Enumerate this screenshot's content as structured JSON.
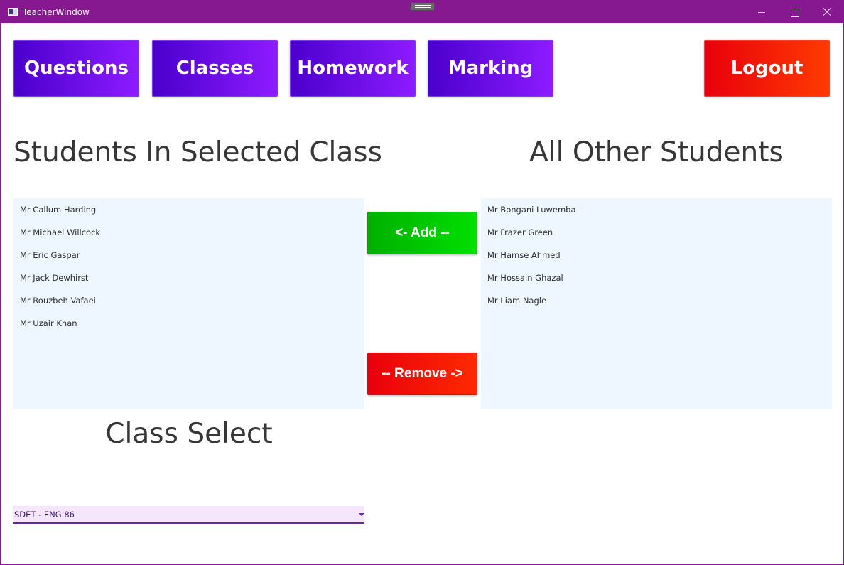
{
  "window": {
    "title": "TeacherWindow"
  },
  "nav": {
    "questions": "Questions",
    "classes": "Classes",
    "homework": "Homework",
    "marking": "Marking",
    "logout": "Logout"
  },
  "headings": {
    "selected_class": "Students In Selected Class",
    "other_students": "All Other Students",
    "class_select": "Class Select"
  },
  "students_in_class": [
    "Mr Callum Harding",
    "Mr Michael Willcock",
    "Mr Eric Gaspar",
    "Mr Jack Dewhirst",
    "Mr Rouzbeh Vafaei",
    "Mr Uzair Khan"
  ],
  "other_students": [
    "Mr Bongani Luwemba",
    "Mr Frazer Green",
    "Mr Hamse Ahmed",
    "Mr Hossain Ghazal",
    "Mr Liam Nagle"
  ],
  "actions": {
    "add": "<- Add --",
    "remove": "-- Remove ->"
  },
  "class_select": {
    "value": "SDET - ENG 86"
  },
  "colors": {
    "titlebar": "#86198f",
    "nav_gradient_start": "#4a00cc",
    "nav_gradient_end": "#8d1bff",
    "logout": "#ff1a00",
    "add": "#00c800",
    "remove": "#f01000",
    "list_bg": "#eef6ff",
    "select_bg": "#f4e6fb"
  }
}
